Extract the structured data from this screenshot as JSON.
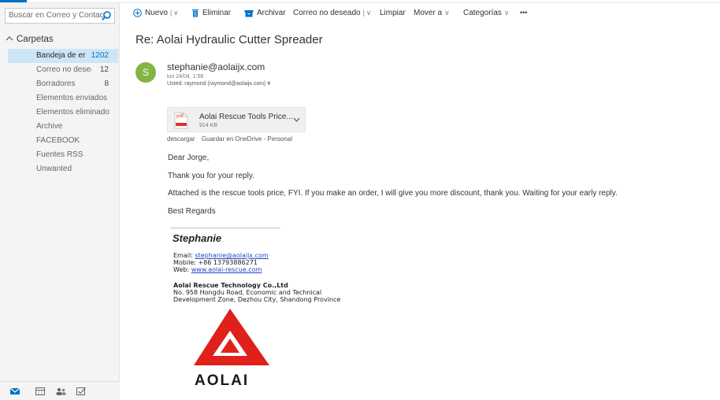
{
  "search": {
    "placeholder": "Buscar en Correo y Contac..."
  },
  "folders": {
    "header": "Carpetas",
    "items": [
      {
        "name": "Bandeja de er",
        "count": "1202",
        "selected": true
      },
      {
        "name": "Correo no desea",
        "count": "12"
      },
      {
        "name": "Borradores",
        "count": "8"
      },
      {
        "name": "Elementos enviados",
        "count": ""
      },
      {
        "name": "Elementos eliminado",
        "count": ""
      },
      {
        "name": "Archive",
        "count": ""
      },
      {
        "name": "FACEBOOK",
        "count": ""
      },
      {
        "name": "Fuentes RSS",
        "count": ""
      },
      {
        "name": "Unwanted",
        "count": ""
      }
    ]
  },
  "toolbar": {
    "new": "Nuevo",
    "delete": "Eliminar",
    "archive": "Archivar",
    "junk": "Correo no deseado",
    "sweep": "Limpiar",
    "move": "Mover a",
    "categories": "Categorías",
    "more": "•••"
  },
  "message": {
    "subject": "Re: Aolai Hydraulic Cutter Spreader",
    "avatar_letter": "S",
    "sender": "stephanie@aolaijx.com",
    "date": "lun 24/04, 1:58",
    "to": "Usted: raymond (raymond@aolaijx.com) ¥",
    "attachment": {
      "name": "Aolai Rescue Tools Price...",
      "size": "914 KB",
      "type_label": "pdf",
      "download": "descargar",
      "onedrive": "Guardar en OneDrive - Personal"
    },
    "body": [
      "Dear Jorge,",
      "Thank you for your reply.",
      "Attached is the rescue tools price, FYI. If you make an order, I will give you more discount, thank you.  Waiting for your early reply.",
      "Best Regards"
    ],
    "signature": {
      "name": "Stephanie",
      "email_label": "Email: ",
      "email": "stephanie@aolaijx.com",
      "mobile": "Mobile: +86 13793886271",
      "web_label": "Web: ",
      "web": "www.aolai-rescue.com",
      "company": "Aolai Rescue Technology Co.,Ltd",
      "address1": "No. 958 Hongdu Road, Economic and Technical",
      "address2": "Development Zone, Dezhou City, Shandong Province",
      "logo_text": "AOLAI"
    }
  },
  "colors": {
    "accent": "#0072c6",
    "selected_folder": "#cde6f7",
    "avatar": "#83b543",
    "logo_red": "#e0201b",
    "link": "#2047c8"
  },
  "icons": {
    "search": "search-icon",
    "new": "plus-circle-icon",
    "delete": "trash-icon",
    "archive": "archive-icon",
    "mail": "mail-icon",
    "calendar": "calendar-icon",
    "people": "people-icon",
    "tasks": "tasks-icon"
  }
}
